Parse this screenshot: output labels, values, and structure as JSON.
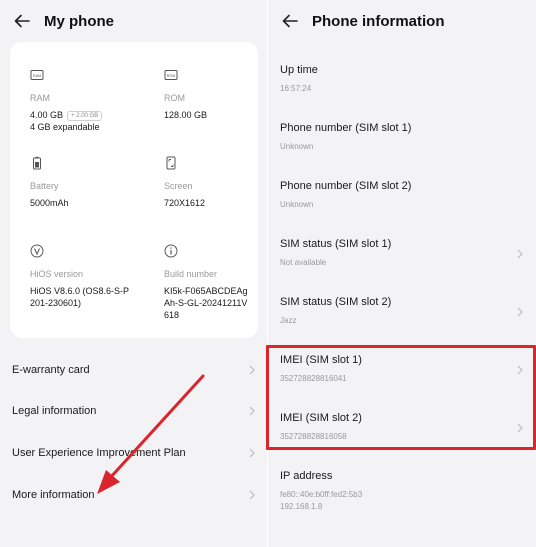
{
  "left": {
    "title": "My phone",
    "specs": {
      "ram": {
        "icon": "ram-icon",
        "label": "RAM",
        "value": "4.00 GB",
        "badge": "+ 2.00 GB",
        "sub": "4 GB expandable"
      },
      "rom": {
        "icon": "rom-icon",
        "label": "ROM",
        "value": "128.00 GB"
      },
      "battery": {
        "icon": "battery-icon",
        "label": "Battery",
        "value": "5000mAh"
      },
      "screen": {
        "icon": "screen-icon",
        "label": "Screen",
        "value": "720X1612"
      },
      "hios": {
        "icon": "hios-icon",
        "label": "HiOS version",
        "value": "HiOS V8.6.0 (OS8.6-S-P201-230601)"
      },
      "build": {
        "icon": "info-icon",
        "label": "Build number",
        "value": "KI5k-F065ABCDEAgAh-S-GL-20241211V618"
      }
    },
    "menu": [
      {
        "label": "E-warranty card"
      },
      {
        "label": "Legal information"
      },
      {
        "label": "User Experience Improvement Plan"
      },
      {
        "label": "More information"
      }
    ]
  },
  "right": {
    "title": "Phone information",
    "items": [
      {
        "title": "Up time",
        "value": "16:57:24"
      },
      {
        "title": "Phone number (SIM slot 1)",
        "value": "Unknown"
      },
      {
        "title": "Phone number (SIM slot 2)",
        "value": "Unknown"
      },
      {
        "title": "SIM status (SIM slot 1)",
        "value": "Not available"
      },
      {
        "title": "SIM status (SIM slot 2)",
        "value": "Jazz"
      },
      {
        "title": "IMEI (SIM slot 1)",
        "value": "352728828816041"
      },
      {
        "title": "IMEI (SIM slot 2)",
        "value": "352728828816058"
      },
      {
        "title": "IP address",
        "value": "fe80::40e:b0ff:fed2:5b3",
        "value2": "192.168.1.8"
      }
    ]
  },
  "colors": {
    "highlight": "#d9252b",
    "arrow": "#d9252b",
    "background": "#f3f3f5",
    "card": "#ffffff"
  }
}
